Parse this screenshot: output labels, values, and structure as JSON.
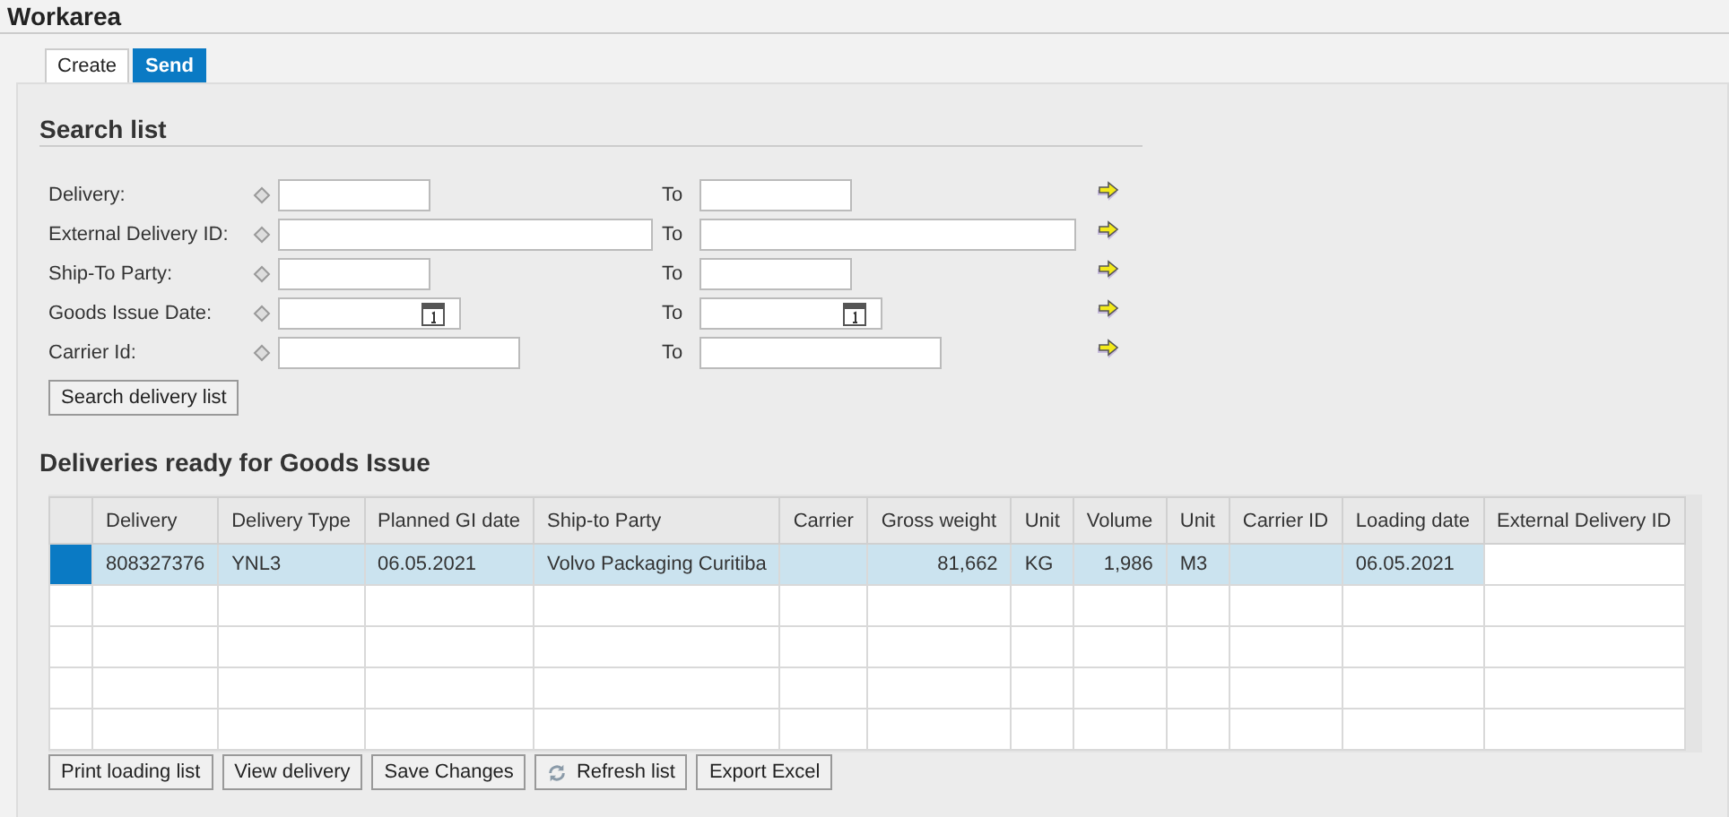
{
  "window": {
    "title": "Workarea"
  },
  "tabs": [
    {
      "label": "Create",
      "selected": false
    },
    {
      "label": "Send",
      "selected": true
    }
  ],
  "search": {
    "heading": "Search list",
    "fields": [
      {
        "label": "Delivery:",
        "kind": "text",
        "to_label": "To"
      },
      {
        "label": "External Delivery ID:",
        "kind": "text",
        "to_label": "To"
      },
      {
        "label": "Ship-To Party:",
        "kind": "text",
        "to_label": "To"
      },
      {
        "label": "Goods Issue Date:",
        "kind": "date",
        "to_label": "To"
      },
      {
        "label": "Carrier Id:",
        "kind": "text",
        "to_label": "To"
      }
    ],
    "button": "Search delivery list"
  },
  "table": {
    "heading": "Deliveries ready for Goods Issue",
    "columns": [
      "Delivery",
      "Delivery Type",
      "Planned GI date",
      "Ship-to Party",
      "Carrier",
      "Gross weight",
      "Unit",
      "Volume",
      "Unit",
      "Carrier ID",
      "Loading date",
      "External Delivery ID"
    ],
    "rows": [
      {
        "selected": true,
        "cells": [
          "808327376",
          "YNL3",
          "06.05.2021",
          "Volvo Packaging Curitiba",
          "",
          "81,662",
          "KG",
          "1,986",
          "M3",
          "",
          "06.05.2021",
          ""
        ]
      }
    ]
  },
  "buttons": [
    {
      "label": "Print loading list",
      "kind": "plain"
    },
    {
      "label": "View delivery",
      "kind": "plain"
    },
    {
      "label": "Save Changes",
      "kind": "plain"
    },
    {
      "label": "Refresh list",
      "kind": "refresh"
    },
    {
      "label": "Export Excel",
      "kind": "plain"
    }
  ]
}
